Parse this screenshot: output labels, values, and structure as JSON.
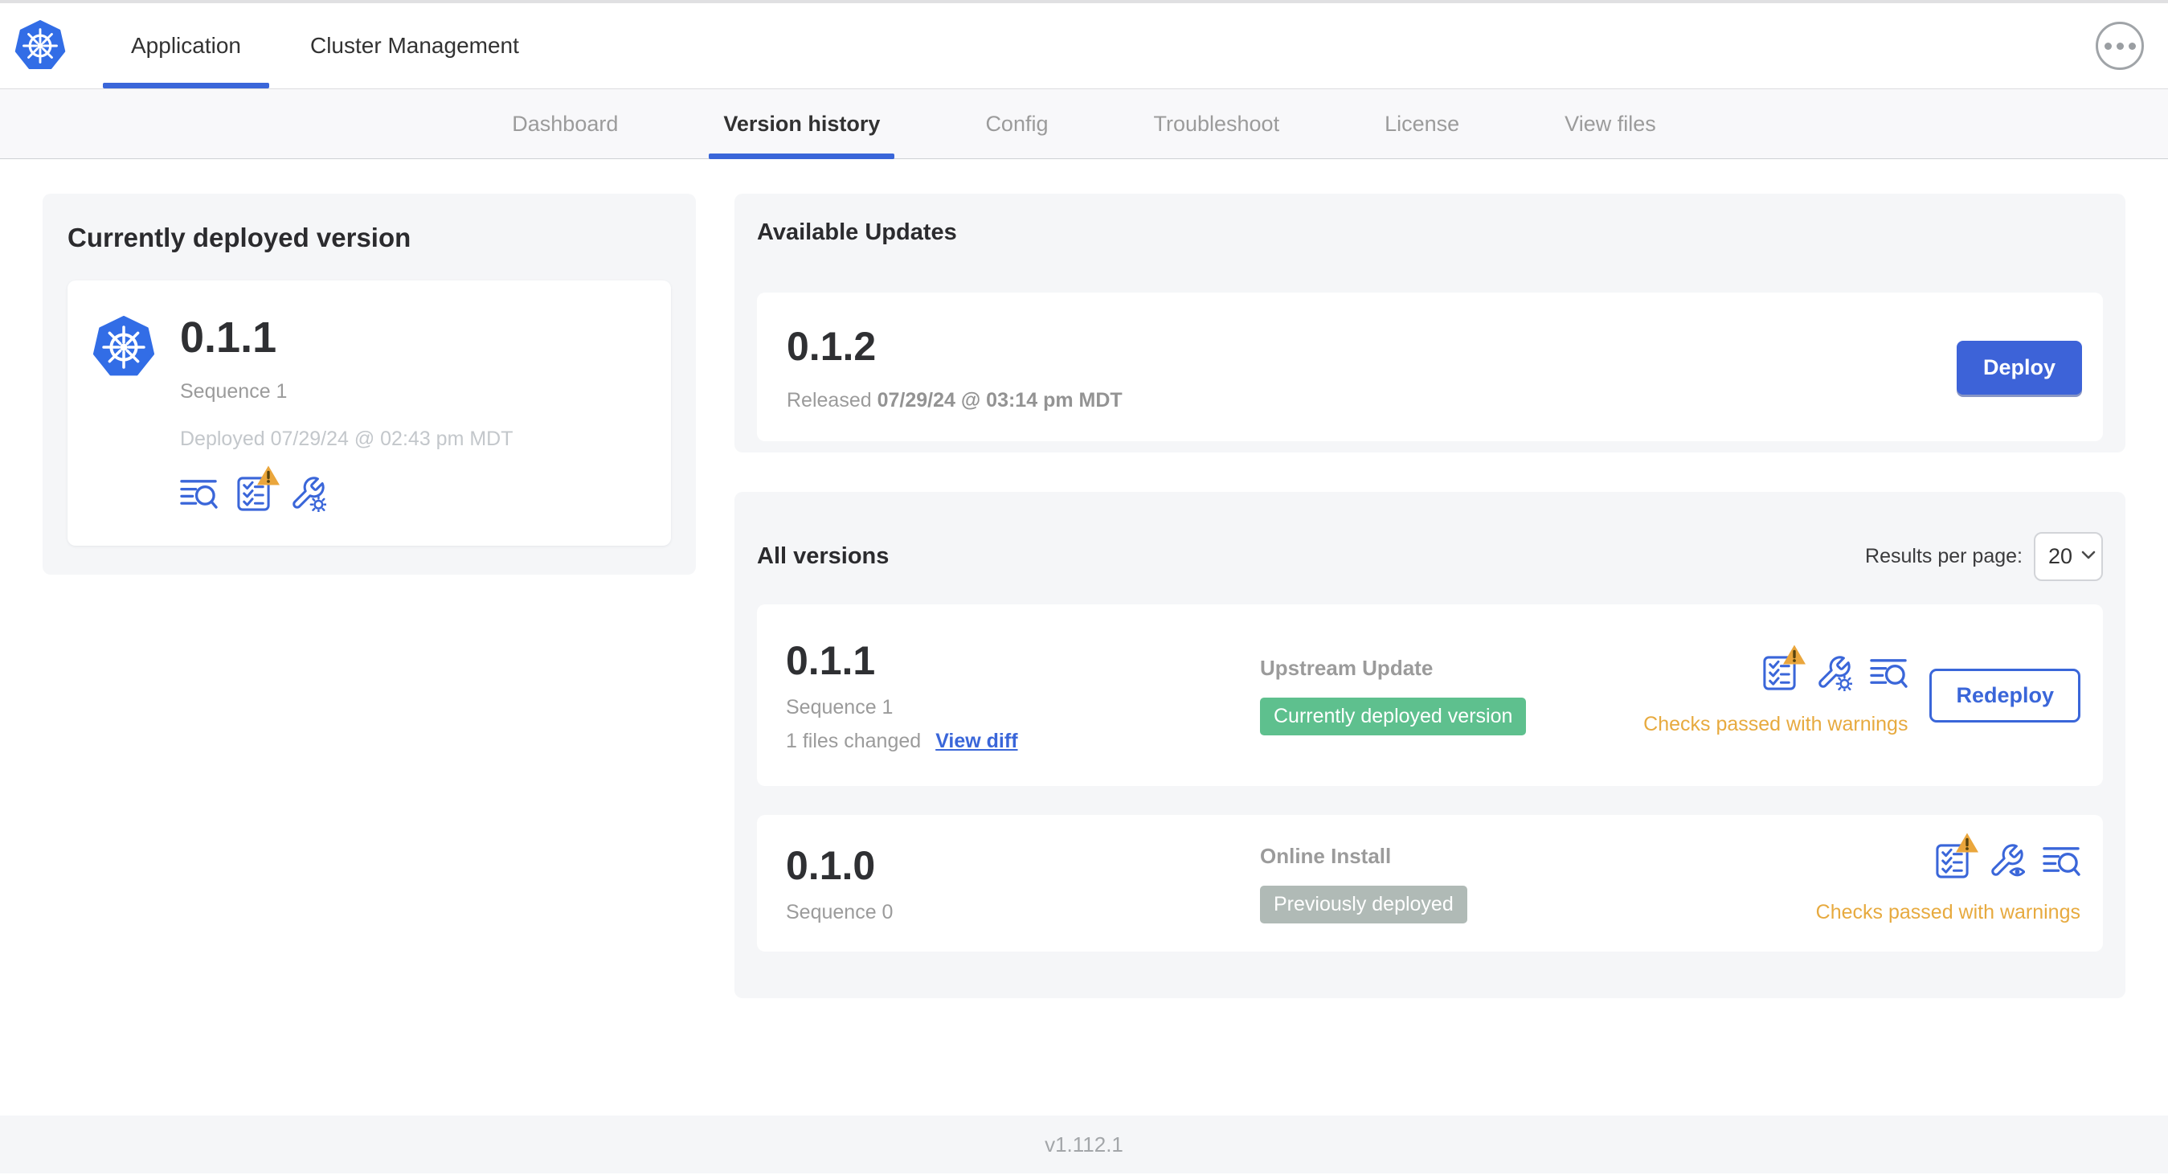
{
  "header": {
    "tabs": [
      {
        "label": "Application",
        "active": true
      },
      {
        "label": "Cluster Management",
        "active": false
      }
    ],
    "menu_icon": "ellipsis-icon",
    "logo_icon": "kubernetes-logo"
  },
  "subnav": {
    "tabs": [
      "Dashboard",
      "Version history",
      "Config",
      "Troubleshoot",
      "License",
      "View files"
    ],
    "active": "Version history"
  },
  "deployed_card": {
    "title": "Currently deployed version",
    "version": "0.1.1",
    "sequence": "Sequence 1",
    "deployed_at": "Deployed 07/29/24 @ 02:43 pm MDT",
    "icons": [
      "diff-icon",
      "preflight-checks-warning-icon",
      "config-gear-icon"
    ]
  },
  "available_updates": {
    "title": "Available Updates",
    "version": "0.1.2",
    "released_prefix": "Released",
    "released_date": "07/29/24 @ 03:14 pm MDT",
    "deploy_label": "Deploy"
  },
  "all_versions": {
    "title": "All versions",
    "results_per_page_label": "Results per page:",
    "results_per_page_value": "20",
    "rows": [
      {
        "version": "0.1.1",
        "sequence": "Sequence 1",
        "files_changed": "1 files changed",
        "view_diff_label": "View diff",
        "source": "Upstream Update",
        "badge_label": "Currently deployed version",
        "badge_color": "#5ec08e",
        "status": "Checks passed with warnings",
        "action_label": "Redeploy",
        "icons": [
          "preflight-checks-warning-icon",
          "config-gear-icon",
          "diff-icon"
        ]
      },
      {
        "version": "0.1.0",
        "sequence": "Sequence 0",
        "source": "Online Install",
        "badge_label": "Previously deployed",
        "badge_color": "#b0bab6",
        "status": "Checks passed with warnings",
        "icons": [
          "preflight-checks-warning-icon",
          "config-eye-icon",
          "diff-icon"
        ]
      }
    ]
  },
  "footer": {
    "version": "v1.112.1"
  },
  "colors": {
    "accent_blue": "#3a66d9",
    "k8s_blue": "#326de6",
    "warning_orange": "#e7aa3f",
    "success_green": "#5ec08e",
    "badge_gray": "#b0bab6",
    "muted_text": "#9b9b9b",
    "panel_bg": "#f5f6f8"
  }
}
